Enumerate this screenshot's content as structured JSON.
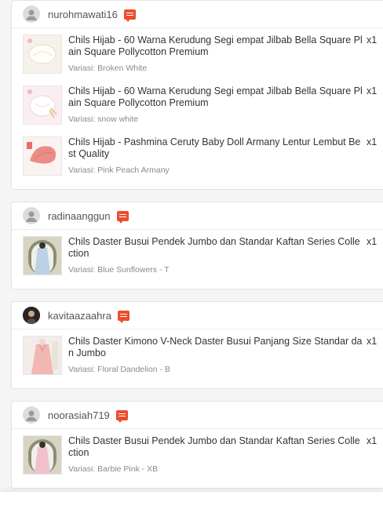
{
  "orders": [
    {
      "username": "nurohmawati16",
      "avatar": "default-avatar",
      "items": [
        {
          "title": "Chils Hijab - 60 Warna Kerudung Segi empat Jilbab Bella Square Plain Square Pollycotton Premium",
          "variation": "Variasi: Broken White",
          "qty": "x1"
        },
        {
          "title": "Chils Hijab - 60 Warna Kerudung Segi empat Jilbab Bella Square Plain Square Pollycotton Premium",
          "variation": "Variasi: snow white",
          "qty": "x1"
        },
        {
          "title": "Chils Hijab - Pashmina Ceruty Baby Doll Armany Lentur Lembut Best Quality",
          "variation": "Variasi: Pink Peach Armany",
          "qty": "x1"
        }
      ]
    },
    {
      "username": "radinaanggun",
      "avatar": "default-avatar",
      "items": [
        {
          "title": "Chils Daster Busui Pendek Jumbo dan Standar Kaftan Series Collection",
          "variation": "Variasi: Blue Sunflowers - T",
          "qty": "x1"
        }
      ]
    },
    {
      "username": "kavitaazaahra",
      "avatar": "photo-avatar",
      "items": [
        {
          "title": "Chils Daster Kimono V-Neck Daster Busui Panjang Size Standar dan Jumbo",
          "variation": "Variasi: Floral Dandelion - B",
          "qty": "x1"
        }
      ]
    },
    {
      "username": "noorasiah719",
      "avatar": "default-avatar",
      "items": [
        {
          "title": "Chils Daster Busui Pendek Jumbo dan Standar Kaftan Series Collection",
          "variation": "Variasi: Barbie Pink - XB",
          "qty": "x1"
        }
      ]
    }
  ],
  "colors": {
    "accent": "#ee4d2d",
    "background": "#f5f5f5"
  }
}
